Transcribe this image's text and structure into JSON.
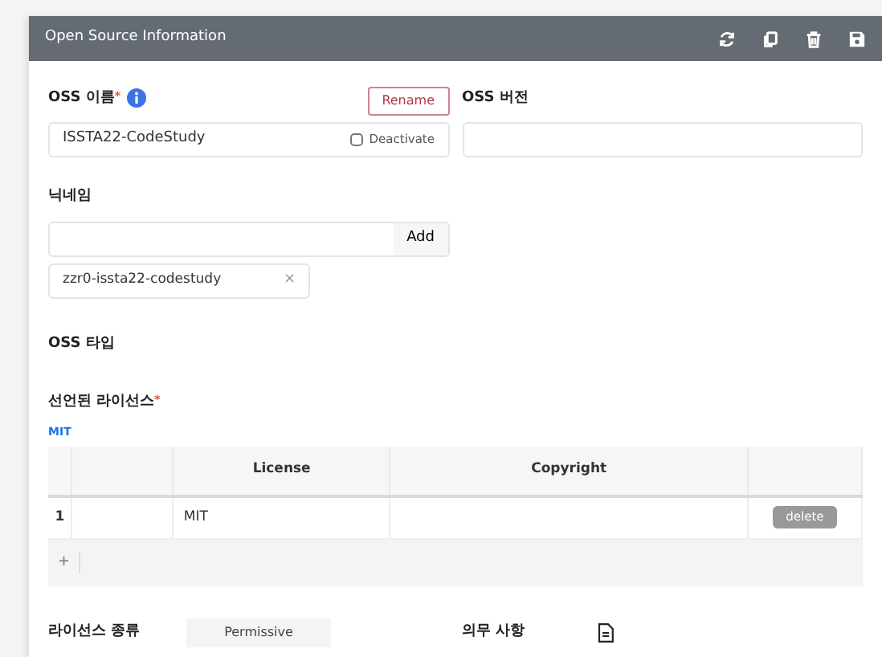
{
  "panel": {
    "title": "Open Source Information"
  },
  "oss_name": {
    "label": "OSS 이름",
    "required_mark": "*",
    "rename_button": "Rename",
    "value": "ISSTA22-CodeStudy",
    "deactivate": {
      "label": "Deactivate",
      "checked": false
    }
  },
  "oss_version": {
    "label": "OSS 버전"
  },
  "nickname": {
    "label": "닉네임",
    "add_button": "Add",
    "tags": [
      {
        "text": "zzr0-issta22-codestudy",
        "remove": "×"
      }
    ]
  },
  "oss_type": {
    "label": "OSS 타입"
  },
  "declared_license": {
    "label": "선언된 라이선스",
    "required_mark": "*",
    "summary": "MIT",
    "table": {
      "columns": [
        "License",
        "Copyright"
      ],
      "rows": [
        {
          "number": "1",
          "license": "MIT",
          "action": "delete"
        }
      ],
      "add": "+"
    }
  },
  "license_type": {
    "label": "라이선스 종류",
    "value": "Permissive"
  },
  "obligation": {
    "label": "의무 사항"
  }
}
